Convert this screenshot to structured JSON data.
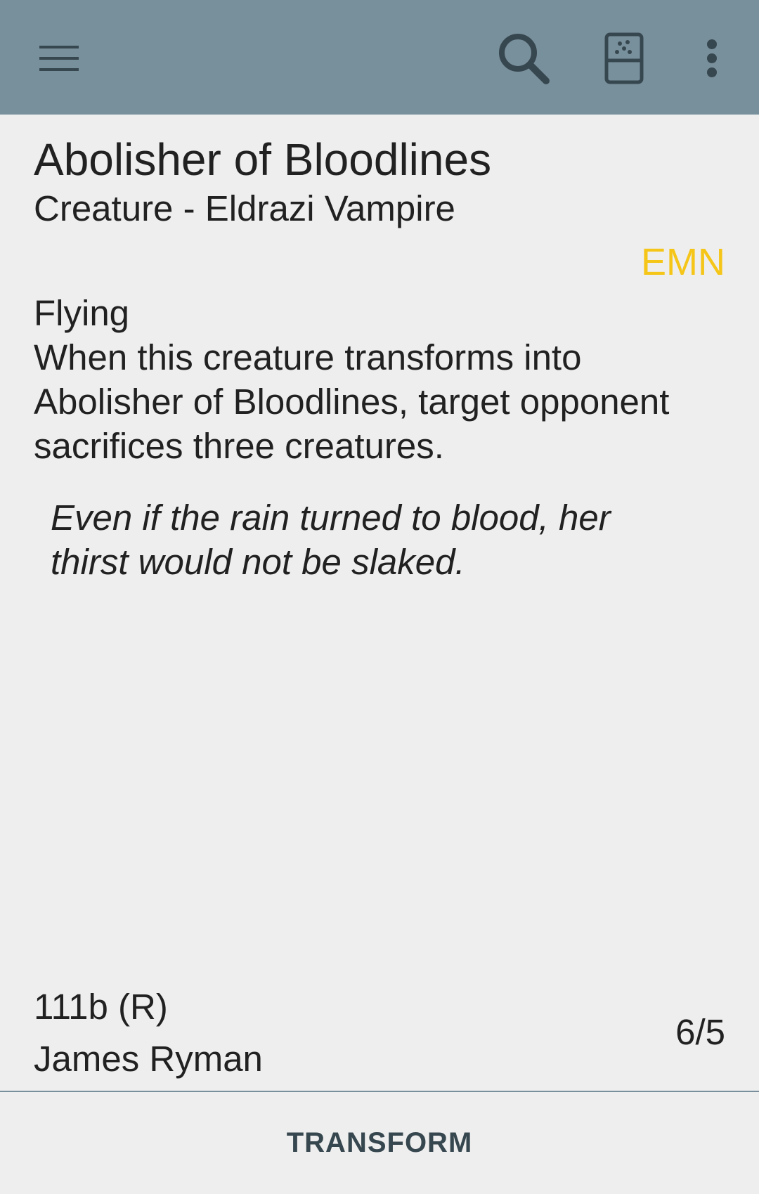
{
  "toolbar": {
    "background": "#78909c",
    "icons": {
      "menu": "hamburger-menu-icon",
      "search": "search-icon",
      "fridge": "fridge-icon",
      "overflow": "more-vert-icon"
    }
  },
  "card": {
    "name": "Abolisher of Bloodlines",
    "type_line": "Creature - Eldrazi Vampire",
    "set_code": "EMN",
    "set_color": "#f5c518",
    "rules_lines": [
      "Flying",
      "When this creature transforms into",
      "Abolisher of Bloodlines, target opponent",
      "sacrifices three creatures."
    ],
    "flavor_lines": [
      "Even if the rain turned to blood, her",
      "thirst would not be slaked."
    ],
    "collector_number": "111b (R)",
    "artist": "James Ryman",
    "power_toughness": "6/5"
  },
  "bottom": {
    "transform_label": "TRANSFORM"
  }
}
